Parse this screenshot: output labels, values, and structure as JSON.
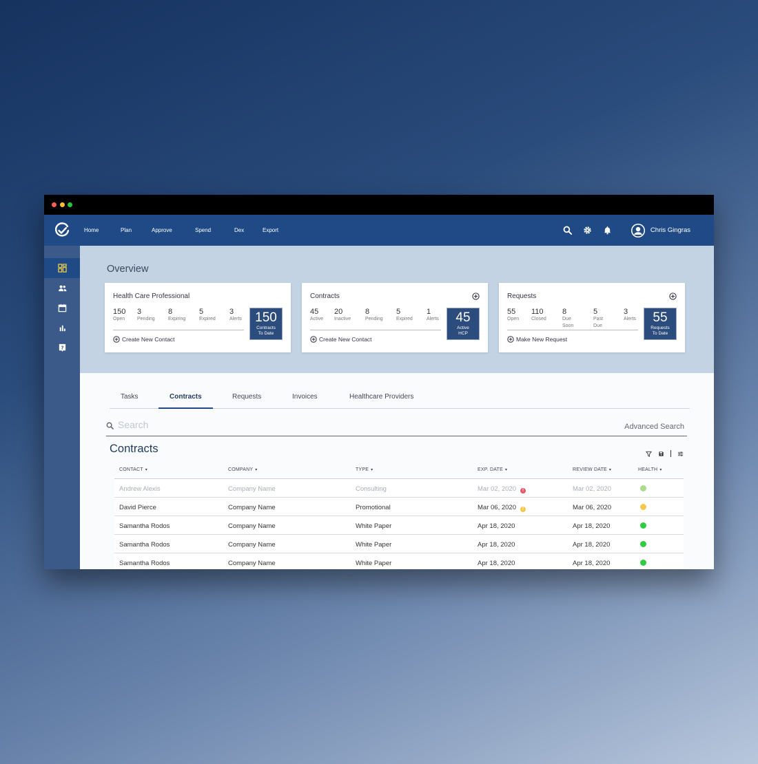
{
  "app": {
    "user_name": "Chris Gingras"
  },
  "nav": {
    "items": [
      "Home",
      "Plan",
      "Approve",
      "Spend",
      "Dex",
      "Export"
    ]
  },
  "overview": {
    "title": "Overview",
    "cards": [
      {
        "title": "Health Care Professional",
        "stats": [
          {
            "num": "150",
            "label": "Open"
          },
          {
            "num": "3",
            "label": "Pending"
          },
          {
            "num": "8",
            "label": "Expiring"
          },
          {
            "num": "5",
            "label": "Expired"
          },
          {
            "num": "3",
            "label": "Alerts"
          }
        ],
        "big_num": "150",
        "big_label": [
          "Contracts",
          "To Date"
        ],
        "action": "Create New Contact"
      },
      {
        "title": "Contracts",
        "stats": [
          {
            "num": "45",
            "label": "Active"
          },
          {
            "num": "20",
            "label": "Inactive"
          },
          {
            "num": "8",
            "label": "Pending"
          },
          {
            "num": "5",
            "label": "Expired"
          },
          {
            "num": "1",
            "label": "Alerts"
          }
        ],
        "big_num": "45",
        "big_label": [
          "Active",
          "HCP"
        ],
        "action": "Create New Contact"
      },
      {
        "title": "Requests",
        "stats": [
          {
            "num": "55",
            "label": "Open"
          },
          {
            "num": "110",
            "label": "Closed"
          },
          {
            "num": "8",
            "label": "Due Soon"
          },
          {
            "num": "5",
            "label": "Past Due"
          },
          {
            "num": "3",
            "label": "Alerts"
          }
        ],
        "big_num": "55",
        "big_label": [
          "Requests",
          "To Date"
        ],
        "action": "Make New Request"
      }
    ]
  },
  "tabs": [
    "Tasks",
    "Contracts",
    "Requests",
    "Invoices",
    "Healthcare Providers"
  ],
  "active_tab": "Contracts",
  "search": {
    "placeholder": "Search",
    "advanced": "Advanced Search"
  },
  "section_title": "Contracts",
  "table": {
    "headers": [
      "CONTACT",
      "COMPANY",
      "TYPE",
      "EXP. DATE",
      "REVIEW DATE",
      "HEALTH"
    ],
    "rows": [
      {
        "contact": "Andrew Alexis",
        "company": "Company Name",
        "type": "Consulting",
        "exp": "Mar 02, 2020",
        "review": "Mar 02, 2020",
        "warn": "#e05a6a",
        "health": "#a9dc8c",
        "faded": true
      },
      {
        "contact": "David Pierce",
        "company": "Company Name",
        "type": "Promotional",
        "exp": "Mar 06, 2020",
        "review": "Mar 06, 2020",
        "warn": "#f2c94c",
        "health": "#f2c94c",
        "faded": false
      },
      {
        "contact": "Samantha Rodos",
        "company": "Company Name",
        "type": "White Paper",
        "exp": "Apr 18, 2020",
        "review": "Apr 18, 2020",
        "warn": null,
        "health": "#2ecc40",
        "faded": false
      },
      {
        "contact": "Samantha Rodos",
        "company": "Company Name",
        "type": "White Paper",
        "exp": "Apr 18, 2020",
        "review": "Apr 18, 2020",
        "warn": null,
        "health": "#2ecc40",
        "faded": false
      },
      {
        "contact": "Samantha Rodos",
        "company": "Company Name",
        "type": "White Paper",
        "exp": "Apr 18, 2020",
        "review": "Apr 18, 2020",
        "warn": null,
        "health": "#2ecc40",
        "faded": false
      }
    ]
  },
  "colors": {
    "nav": "#1f4a85",
    "sidebar": "#3b5a8a",
    "overview_bg": "#c3d3e4",
    "accent": "#2b4c7c"
  }
}
